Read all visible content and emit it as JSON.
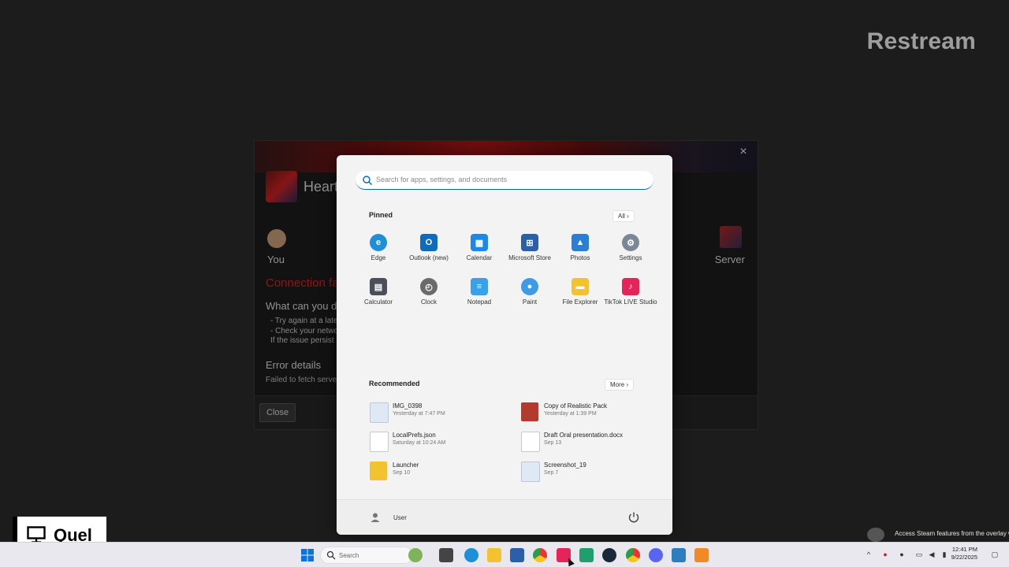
{
  "brand": {
    "restream": "Restream",
    "quel": "Quel"
  },
  "error_dialog": {
    "close_symbol": "×",
    "title": "Heart",
    "you_label": "You",
    "server_label": "Server",
    "connection_failed": "Connection fa",
    "what_can_you_do": "What can you do",
    "tips": [
      "- Try again at a later",
      "- Check your netwo",
      "  If the issue persist"
    ],
    "error_details": "Error details",
    "error_message": "Failed to fetch serve",
    "close_button": "Close"
  },
  "start_menu": {
    "search_placeholder": "Search for apps, settings, and documents",
    "pinned_title": "Pinned",
    "all_button": "All ›",
    "pinned_apps": [
      {
        "label": "Edge",
        "icon": "edge-icon",
        "color": "#1f8fd8"
      },
      {
        "label": "Outlook (new)",
        "icon": "outlook-icon",
        "color": "#0f6cbd"
      },
      {
        "label": "Calendar",
        "icon": "calendar-icon",
        "color": "#1e88e5"
      },
      {
        "label": "Microsoft Store",
        "icon": "store-icon",
        "color": "#2b5fa8"
      },
      {
        "label": "Photos",
        "icon": "photos-icon",
        "color": "#2a7fd4"
      },
      {
        "label": "Settings",
        "icon": "gear-icon",
        "color": "#7a8896"
      },
      {
        "label": "Calculator",
        "icon": "calculator-icon",
        "color": "#4a4f59"
      },
      {
        "label": "Clock",
        "icon": "clock-icon",
        "color": "#6b6b6b"
      },
      {
        "label": "Notepad",
        "icon": "notepad-icon",
        "color": "#3aa0e8"
      },
      {
        "label": "Paint",
        "icon": "paint-icon",
        "color": "#3d9be8"
      },
      {
        "label": "File Explorer",
        "icon": "folder-icon",
        "color": "#f2c230"
      },
      {
        "label": "TikTok LIVE Studio",
        "icon": "tiktok-icon",
        "color": "#e5245c"
      }
    ],
    "recommended_title": "Recommended",
    "more_button": "More ›",
    "recommended": [
      {
        "name": "IMG_0398",
        "sub": "Yesterday at 7:47 PM",
        "icon": "image-file-icon",
        "color": "#dfe9f5"
      },
      {
        "name": "Copy of Realistic Pack",
        "sub": "Yesterday at 1:39 PM",
        "icon": "archive-icon",
        "color": "#b33a2c"
      },
      {
        "name": "LocalPrefs.json",
        "sub": "Saturday at 10:24 AM",
        "icon": "file-icon",
        "color": "#ffffff"
      },
      {
        "name": "Draft Oral presentation.docx",
        "sub": "Sep 13",
        "icon": "file-icon",
        "color": "#ffffff"
      },
      {
        "name": "Launcher",
        "sub": "Sep 10",
        "icon": "folder-icon",
        "color": "#f2c230"
      },
      {
        "name": "Screenshot_19",
        "sub": "Sep 7",
        "icon": "image-file-icon",
        "color": "#dfe9f5"
      }
    ],
    "user_name": "User"
  },
  "toast": {
    "text": "Access Steam features from the overlay while playing"
  },
  "taskbar": {
    "search_label": "Search",
    "time": "12:41 PM",
    "date": "9/22/2025"
  }
}
